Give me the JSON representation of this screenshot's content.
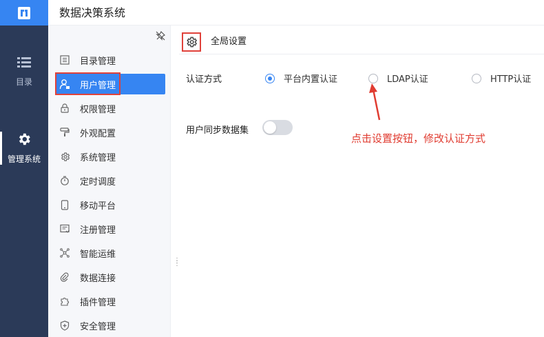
{
  "app": {
    "title": "数据决策系统"
  },
  "rail": {
    "items": [
      {
        "label": "目录",
        "icon": "list-icon",
        "active": false
      },
      {
        "label": "管理系统",
        "icon": "gear-icon",
        "active": true
      }
    ]
  },
  "menu": {
    "items": [
      {
        "label": "目录管理",
        "icon": "catalog-icon"
      },
      {
        "label": "用户管理",
        "icon": "user-icon",
        "active": true
      },
      {
        "label": "权限管理",
        "icon": "lock-icon"
      },
      {
        "label": "外观配置",
        "icon": "paint-roller-icon"
      },
      {
        "label": "系统管理",
        "icon": "gear-icon"
      },
      {
        "label": "定时调度",
        "icon": "timer-icon"
      },
      {
        "label": "移动平台",
        "icon": "mobile-icon"
      },
      {
        "label": "注册管理",
        "icon": "register-icon"
      },
      {
        "label": "智能运维",
        "icon": "network-icon"
      },
      {
        "label": "数据连接",
        "icon": "link-icon"
      },
      {
        "label": "插件管理",
        "icon": "puzzle-icon"
      },
      {
        "label": "安全管理",
        "icon": "shield-icon"
      }
    ]
  },
  "content": {
    "subheader_title": "全局设置",
    "auth": {
      "label": "认证方式",
      "options": [
        {
          "label": "平台内置认证",
          "checked": true
        },
        {
          "label": "LDAP认证",
          "checked": false
        },
        {
          "label": "HTTP认证",
          "checked": false
        }
      ]
    },
    "sync": {
      "label": "用户同步数据集",
      "enabled": false
    },
    "annotation": "点击设置按钮，修改认证方式"
  },
  "colors": {
    "accent": "#3685f2",
    "rail_bg": "#2b3a58",
    "highlight_red": "#e0413a"
  }
}
